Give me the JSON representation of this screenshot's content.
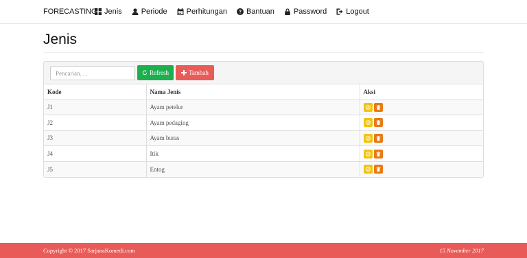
{
  "navbar": {
    "brand": "FORECASTING",
    "items": [
      {
        "label": "Jenis",
        "icon": "grid-icon"
      },
      {
        "label": "Periode",
        "icon": "user-icon"
      },
      {
        "label": "Perhitungan",
        "icon": "calendar-icon"
      },
      {
        "label": "Bantuan",
        "icon": "question-icon"
      },
      {
        "label": "Password",
        "icon": "lock-icon"
      },
      {
        "label": "Logout",
        "icon": "logout-icon"
      }
    ]
  },
  "page": {
    "title": "Jenis"
  },
  "toolbar": {
    "search_placeholder": "Pencarian. . .",
    "refresh_label": "Refresh",
    "add_label": "Tambah"
  },
  "table": {
    "headers": [
      "Kode",
      "Nama Jenis",
      "Aksi"
    ],
    "rows": [
      {
        "kode": "J1",
        "nama": "Ayam petelur"
      },
      {
        "kode": "J2",
        "nama": "Ayam pedaging"
      },
      {
        "kode": "J3",
        "nama": "Ayam buras"
      },
      {
        "kode": "J4",
        "nama": "Itik"
      },
      {
        "kode": "J5",
        "nama": "Entog"
      }
    ]
  },
  "footer": {
    "copyright": "Copyright © 2017 SarjanaKomedi.com",
    "date": "15 November 2017"
  },
  "colors": {
    "refresh": "#1fae4d",
    "add": "#e95b58",
    "edit": "#f1c40f",
    "delete": "#ea7a14",
    "footer": "#e95b58"
  }
}
